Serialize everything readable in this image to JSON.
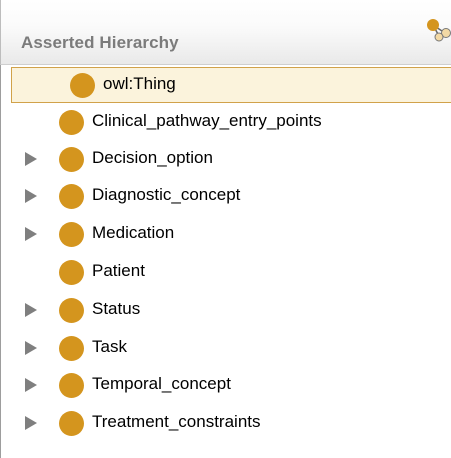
{
  "panel": {
    "title": "Asserted Hierarchy",
    "action_icon": "add-subclass-icon"
  },
  "tree": {
    "root": {
      "label": "owl:Thing",
      "selected": true,
      "icon": "class-circle-icon",
      "icon_color": "#efcf8d"
    },
    "children": [
      {
        "label": "Clinical_pathway_entry_points",
        "expandable": false
      },
      {
        "label": "Decision_option",
        "expandable": true
      },
      {
        "label": "Diagnostic_concept",
        "expandable": true
      },
      {
        "label": "Medication",
        "expandable": true
      },
      {
        "label": "Patient",
        "expandable": false
      },
      {
        "label": "Status",
        "expandable": true
      },
      {
        "label": "Task",
        "expandable": true
      },
      {
        "label": "Temporal_concept",
        "expandable": true
      },
      {
        "label": "Treatment_constraints",
        "expandable": true
      }
    ],
    "class_icon_color": "#d4951e",
    "selection_color": "#fbf3dc"
  }
}
